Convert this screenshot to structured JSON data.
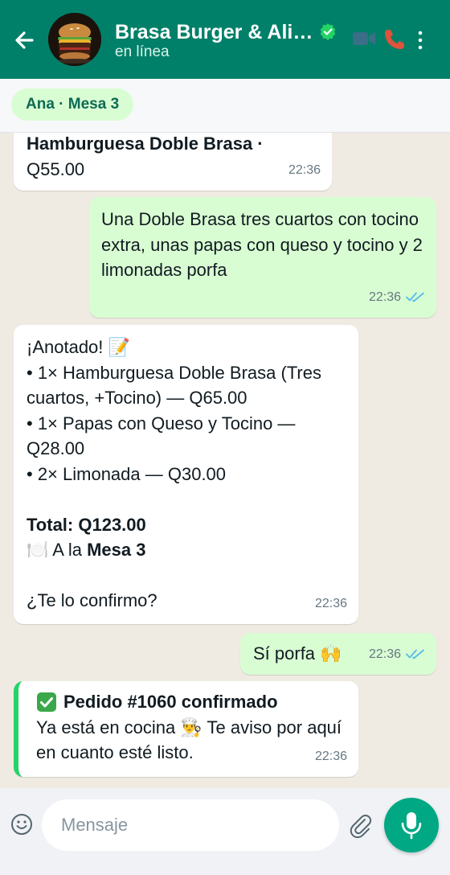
{
  "header": {
    "title": "Brasa Burger & Ali…",
    "status": "en línea",
    "colors": {
      "bar": "#008069",
      "text": "#ffffff"
    },
    "icons": [
      "back-arrow-icon",
      "verified-badge-icon",
      "video-call-icon",
      "phone-call-icon",
      "more-options-icon"
    ]
  },
  "table_chip": {
    "label": "Ana · Mesa 3"
  },
  "messages": [
    {
      "direction": "incoming",
      "line1": "Hamburguesa Doble Brasa ·",
      "line2": "Q55.00",
      "time": "22:36"
    },
    {
      "direction": "outgoing",
      "text": "Una Doble Brasa tres cuartos con tocino extra, unas papas con queso y tocino y 2 limonadas porfa",
      "time": "22:36",
      "status": "read"
    },
    {
      "direction": "incoming",
      "heading": "¡Anotado! 📝",
      "items": [
        "• 1× Hamburguesa Doble Brasa (Tres cuartos, +Tocino) — Q65.00",
        "• 1× Papas con Queso y Tocino — Q28.00",
        "• 2× Limonada — Q30.00"
      ],
      "total": "Total: Q123.00",
      "table_prefix": "🍽️ A la ",
      "table_name": "Mesa 3",
      "question": "¿Te lo confirmo?",
      "time": "22:36"
    },
    {
      "direction": "outgoing",
      "text": "Sí porfa 🙌",
      "time": "22:36",
      "status": "read"
    },
    {
      "direction": "incoming",
      "title": "Pedido #1060 confirmado",
      "body": "Ya está en cocina 👨‍🍳 Te aviso por aquí en cuanto esté listo.",
      "time": "22:36",
      "accent": "#25d366"
    }
  ],
  "composer": {
    "placeholder": "Mensaje",
    "icons": [
      "emoji-icon",
      "attach-icon",
      "microphone-icon"
    ],
    "send_color": "#00a884"
  },
  "colors": {
    "chat_background": "#efeae2",
    "incoming_bubble": "#ffffff",
    "outgoing_bubble": "#d9fdd3",
    "read_ticks": "#53bdeb"
  }
}
